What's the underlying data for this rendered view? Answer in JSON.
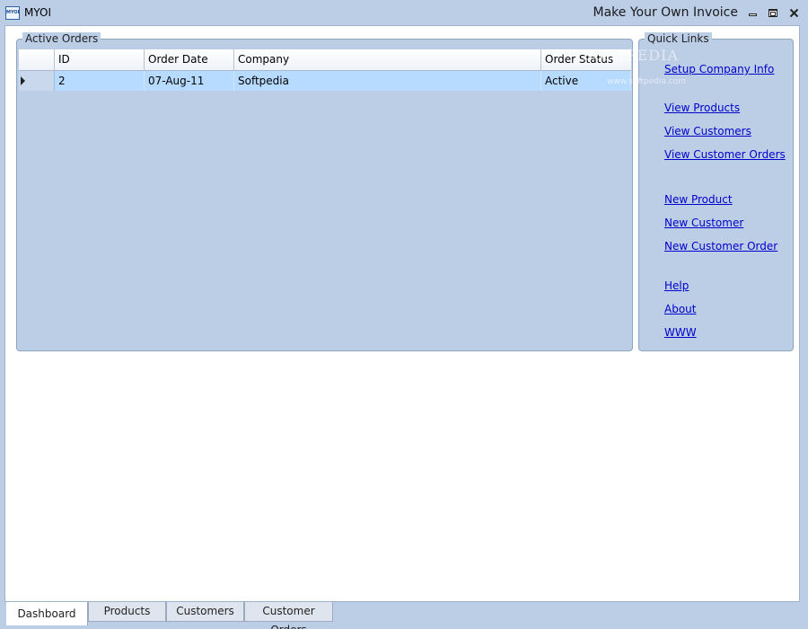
{
  "window": {
    "app_short_name": "MYOI",
    "icon_text": "MYOI",
    "title": "Make Your Own Invoice"
  },
  "active_orders": {
    "legend": "Active Orders",
    "columns": [
      "",
      "ID",
      "Order Date",
      "Company",
      "Order Status"
    ],
    "rows": [
      {
        "id": "2",
        "order_date": "07-Aug-11",
        "company": "Softpedia",
        "order_status": "Active"
      }
    ]
  },
  "quick_links": {
    "legend": "Quick Links",
    "items": [
      "Setup Company Info",
      "View Products",
      "View Customers",
      "View Customer Orders",
      "New Product",
      "New Customer",
      "New Customer Order",
      "Help",
      "About",
      "WWW"
    ]
  },
  "watermark": {
    "main": "SOFTPEDIA",
    "sub": "www.softpedia.com"
  },
  "tabs": [
    {
      "label": "Dashboard",
      "active": true
    },
    {
      "label": "Products",
      "active": false
    },
    {
      "label": "Customers",
      "active": false
    },
    {
      "label": "Customer Orders",
      "active": false
    }
  ],
  "colors": {
    "window_bg": "#bccde6",
    "selected_row": "#b7dbff",
    "link": "#0000cc"
  }
}
